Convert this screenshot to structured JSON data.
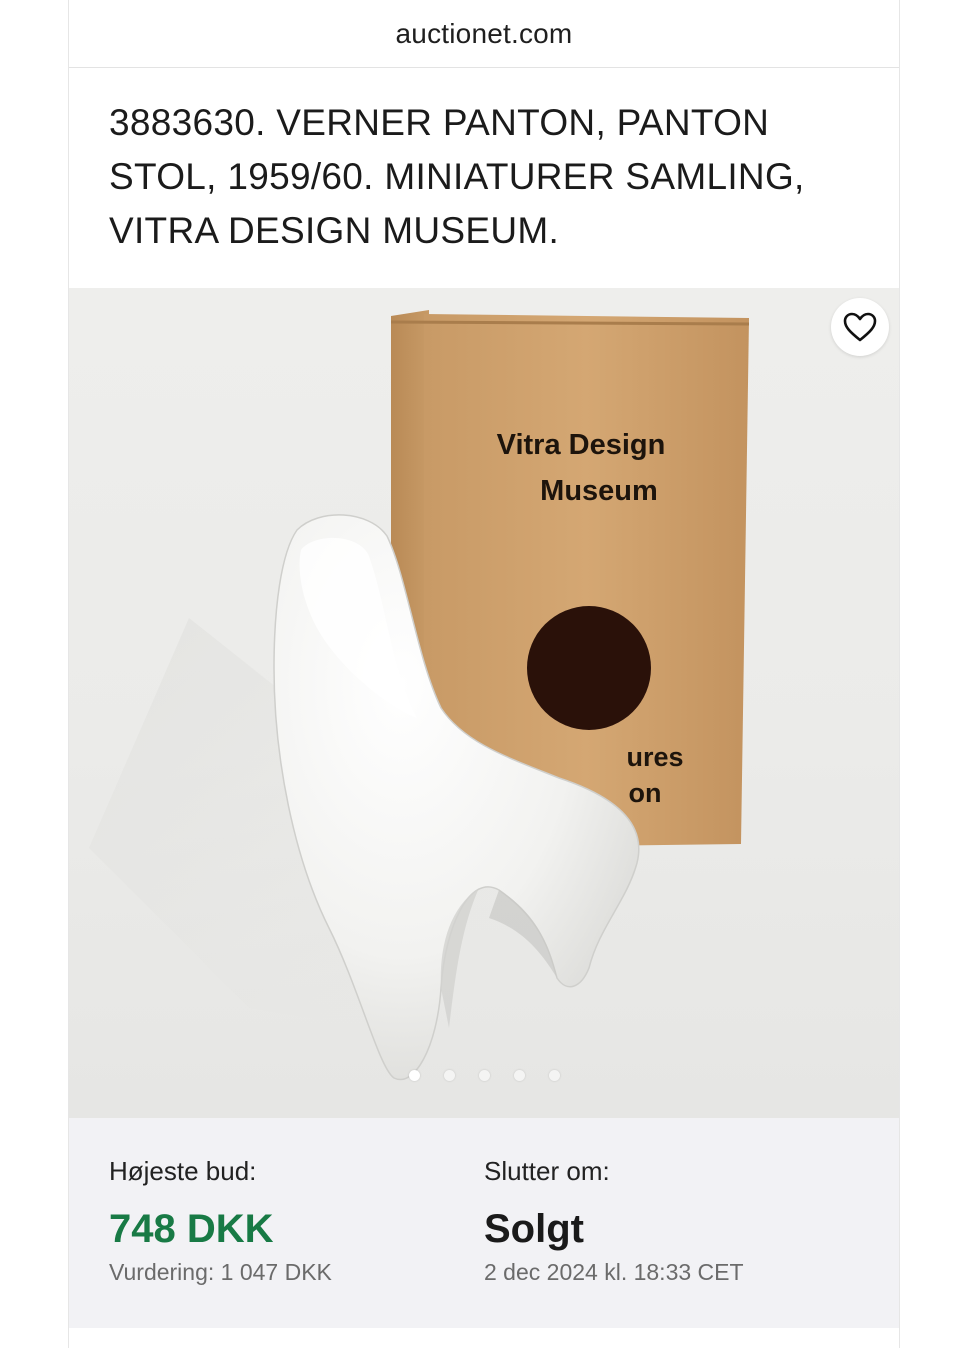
{
  "browser": {
    "url": "auctionet.com"
  },
  "listing": {
    "title": "3883630. VERNER PANTON, PANTON STOL, 1959/60. MINIATURER SAMLING, VITRA DESIGN MUSEUM.",
    "image": {
      "box_text_line1": "Vitra Design",
      "box_text_line2": "Museum",
      "box_text_partial1": "ures",
      "box_text_partial2": "on",
      "pagination": {
        "total": 5,
        "active": 1
      }
    },
    "favorite_icon": "heart-icon"
  },
  "bidding": {
    "highest_bid_label": "Højeste bud:",
    "highest_bid_value": "748 DKK",
    "estimate": "Vurdering: 1 047 DKK",
    "ends_label": "Slutter om:",
    "ends_value": "Solgt",
    "ends_date": "2 dec 2024 kl. 18:33 CET"
  },
  "colors": {
    "bid_green": "#187a45",
    "panel_bg": "#f2f2f5"
  }
}
